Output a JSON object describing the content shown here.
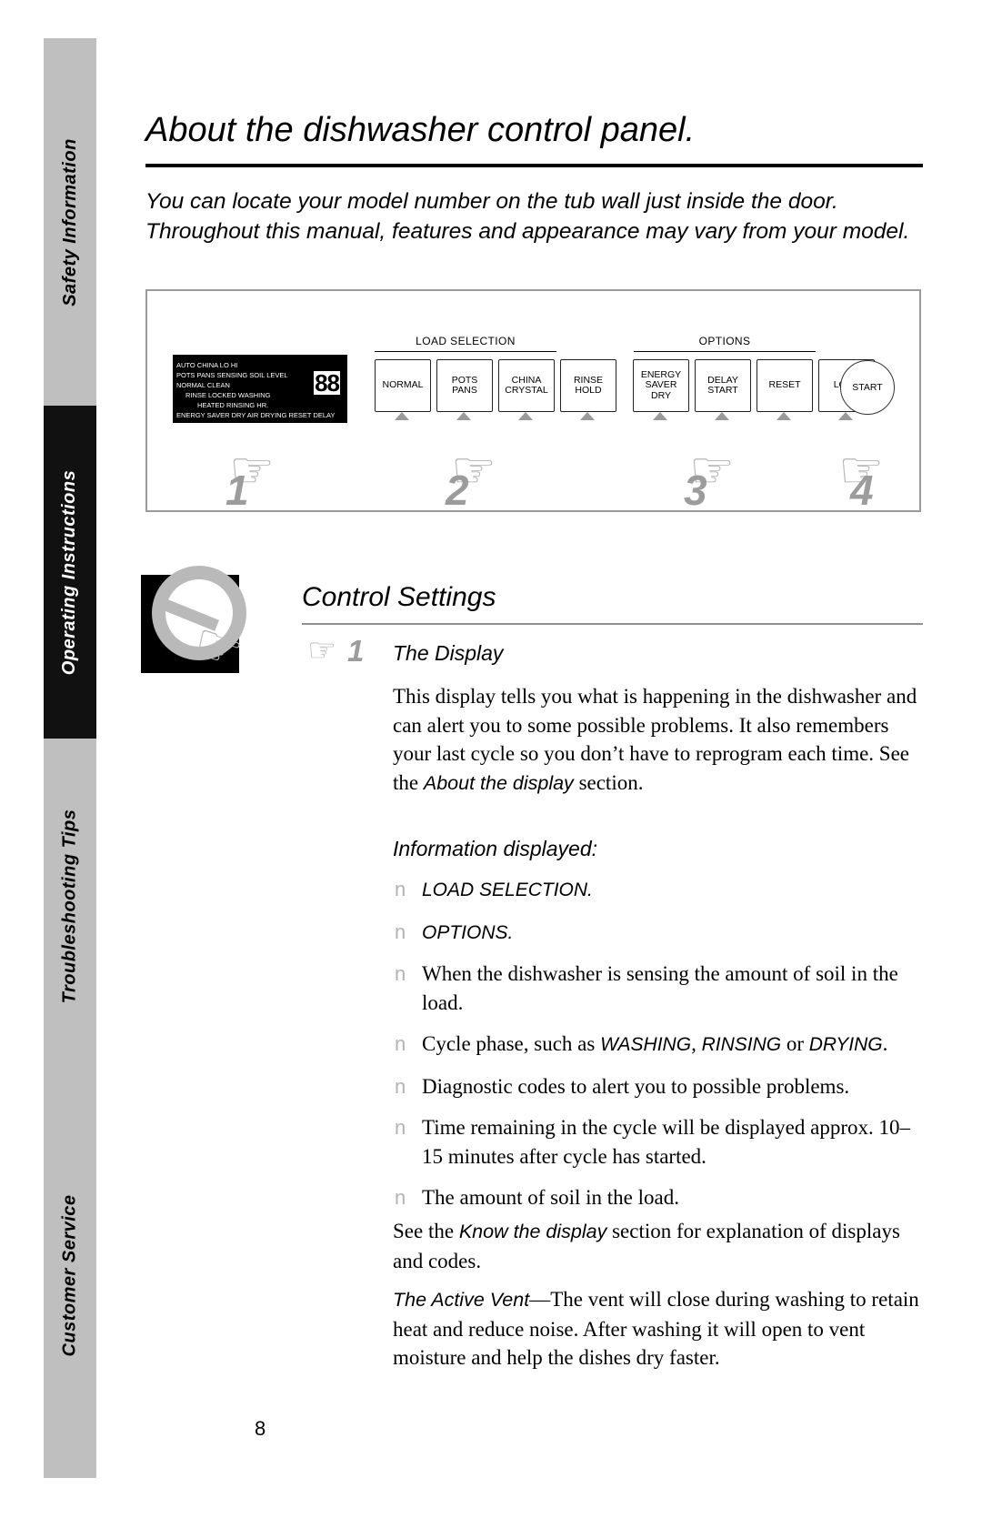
{
  "sidebar": {
    "tabs": [
      {
        "label": "Safety Information",
        "dark": false
      },
      {
        "label": "Operating Instructions",
        "dark": true
      },
      {
        "label": "Troubleshooting Tips",
        "dark": false
      },
      {
        "label": "Customer Service",
        "dark": false
      }
    ]
  },
  "page": {
    "title": "About the dishwasher control panel.",
    "intro_line1": "You can locate your model number on the tub wall just inside the door.",
    "intro_line2": "Throughout this manual, features and appearance may vary from your model.",
    "number": "8"
  },
  "panel": {
    "display": {
      "row1": "AUTO CHINA    LO  HI",
      "row2": "POTS PANS      SENSING SOIL LEVEL",
      "row3": "NORMAL                CLEAN",
      "row4": "RINSE    LOCKED WASHING",
      "row5": "HEATED RINSING       HR.",
      "row6": "ENERGY SAVER DRY AIR DRYING   RESET DELAY",
      "segments": "88"
    },
    "groups": [
      {
        "label": "LOAD SELECTION"
      },
      {
        "label": "OPTIONS"
      }
    ],
    "buttons": [
      {
        "name": "normal",
        "label": "NORMAL"
      },
      {
        "name": "pots-pans",
        "label": "POTS\nPANS"
      },
      {
        "name": "china-crystal",
        "label": "CHINA\nCRYSTAL"
      },
      {
        "name": "rinse-hold",
        "label": "RINSE\nHOLD"
      },
      {
        "name": "energy-saver-dry",
        "label": "ENERGY\nSAVER\nDRY"
      },
      {
        "name": "delay-start",
        "label": "DELAY\nSTART"
      },
      {
        "name": "reset",
        "label": "RESET"
      },
      {
        "name": "lock",
        "label": "LOCK"
      }
    ],
    "start_label": "START",
    "callouts": [
      "1",
      "2",
      "3",
      "4"
    ]
  },
  "control_settings": {
    "heading": "Control Settings",
    "step_number": "1",
    "step_title": "The Display",
    "paragraph1_part1": "This display tells you what is happening in the dishwasher and can alert you to some possible problems. It also remembers your last cycle so you don’t have to reprogram each time. See the ",
    "paragraph1_italic": "About the display",
    "paragraph1_part2": " section.",
    "info_heading": "Information displayed:",
    "bullets": [
      {
        "marker": "n",
        "text": "LOAD SELECTION.",
        "style": "sans-italic"
      },
      {
        "marker": "n",
        "text": "OPTIONS.",
        "style": "sans-italic"
      },
      {
        "marker": "n",
        "text": "When the dishwasher is sensing the amount of soil in the load.",
        "style": "serif"
      },
      {
        "marker": "n",
        "text": "Cycle phase, such as WASHING, RINSING or DRYING.",
        "style": "mixed",
        "pre": "Cycle phase, such as ",
        "em1": "WASHING",
        "mid1": ", ",
        "em2": "RINSING",
        "mid2": " or ",
        "em3": "DRYING",
        "post": "."
      },
      {
        "marker": "n",
        "text": "Diagnostic codes to alert you to possible problems.",
        "style": "serif"
      },
      {
        "marker": "n",
        "text": "Time remaining in the cycle will be displayed approx. 10–15 minutes after cycle has started.",
        "style": "serif"
      },
      {
        "marker": "n",
        "text": "The amount of soil in the load.",
        "style": "serif"
      }
    ],
    "paragraph2_pre": "See the ",
    "paragraph2_em": "Know the display",
    "paragraph2_post": " section for explanation of displays and codes.",
    "paragraph3_em": "The Active Vent",
    "paragraph3_post": "—The vent will close during washing to retain heat and reduce noise. After washing it will open to vent moisture and help the dishes dry faster."
  },
  "colors": {
    "tab_gray": "#bfbfbf",
    "tab_active": "#111111",
    "art_gray": "#b5b5b5",
    "rule": "#000000"
  }
}
